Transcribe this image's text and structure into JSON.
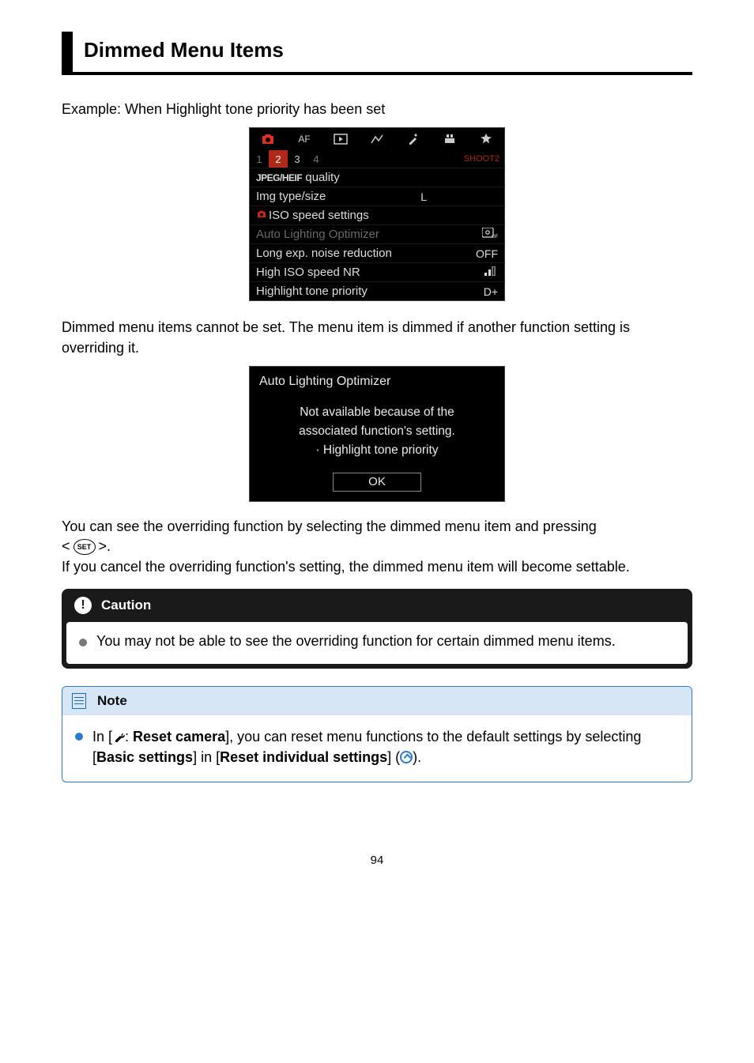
{
  "title": "Dimmed Menu Items",
  "example_line": "Example: When Highlight tone priority has been set",
  "menu": {
    "page_label": "SHOOT2",
    "subtabs": [
      "1",
      "2",
      "3",
      "4"
    ],
    "active_subtab": "2",
    "rows": [
      {
        "label_prefix": "JPEG/HEIF",
        "label": "quality",
        "value": ""
      },
      {
        "label": "Img type/size",
        "value": "L"
      },
      {
        "label": "ISO speed settings",
        "value": "",
        "prefix_cam": true
      },
      {
        "label": "Auto Lighting Optimizer",
        "value_icon": "alo-off",
        "dimmed": true
      },
      {
        "label": "Long exp. noise reduction",
        "value": "OFF"
      },
      {
        "label": "High ISO speed NR",
        "value_icon": "nr-low"
      },
      {
        "label": "Highlight tone priority",
        "value": "D+"
      }
    ]
  },
  "explain1": "Dimmed menu items cannot be set. The menu item is dimmed if another function setting is overriding it.",
  "dialog": {
    "title": "Auto Lighting Optimizer",
    "line1": "Not available because of the",
    "line2": "associated function's setting.",
    "line3": "· Highlight tone priority",
    "ok": "OK"
  },
  "explain2": "You can see the overriding function by selecting the dimmed menu item and pressing",
  "set_label": "SET",
  "explain3": "If you cancel the overriding function's setting, the dimmed menu item will become settable.",
  "caution": {
    "header": "Caution",
    "body": "You may not be able to see the overriding function for certain dimmed menu items."
  },
  "note": {
    "header": "Note",
    "pre": "In [",
    "reset_camera": "Reset camera",
    "mid1": "], you can reset menu functions to the default settings by selecting [",
    "basic": "Basic settings",
    "mid2": "] in [",
    "indiv": "Reset individual settings",
    "mid3": "] (",
    "mid4": ")."
  },
  "pagenum": "94"
}
